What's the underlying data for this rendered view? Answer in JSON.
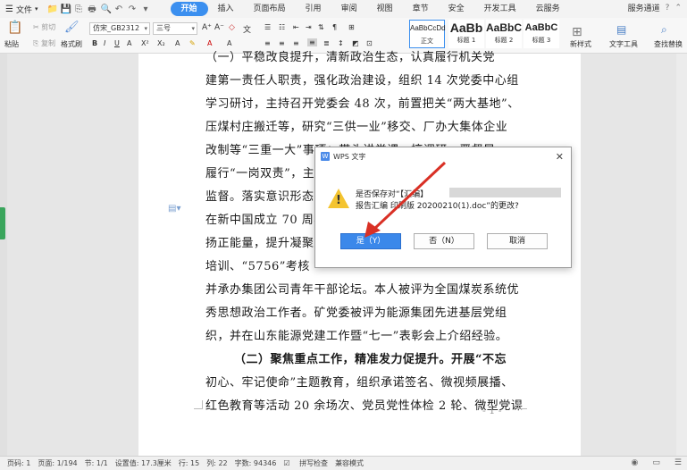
{
  "menubar": {
    "file_label": "文件",
    "tabs": [
      "开始",
      "插入",
      "页面布局",
      "引用",
      "审阅",
      "视图",
      "章节",
      "安全",
      "开发工具",
      "云服务"
    ],
    "active_tab": "开始",
    "right_label": "服务通道"
  },
  "ribbon": {
    "paste": "粘贴",
    "cut": "剪切",
    "copy": "复制",
    "format_painter": "格式刷",
    "font_name": "仿宋_GB2312",
    "font_size": "三号",
    "styles": [
      {
        "preview": "AaBbCcDd",
        "label": "正文"
      },
      {
        "preview": "AaBb",
        "label": "标题 1"
      },
      {
        "preview": "AaBbC",
        "label": "标题 2"
      },
      {
        "preview": "AaBbC",
        "label": "标题 3"
      }
    ],
    "new_style": "新样式",
    "text_tools": "文字工具",
    "find_replace": "查找替换"
  },
  "document": {
    "lines": [
      {
        "text": "（一）平稳改良提升，清新政治生态，认真履行机关党",
        "bold": false
      },
      {
        "text": "建第一责任人职责，强化政治建设，组织 14 次党委中心组",
        "bold": false
      },
      {
        "text": "学习研讨，主持召开党委会 48 次，前置把关“两大基地”、",
        "bold": false
      },
      {
        "text": "压煤村庄搬迁等，研究“三供一业”移交、厂办大集体企业",
        "bold": false
      },
      {
        "text": "改制等“三重一大”事项；带头讲党课，搞调研，严督导，",
        "bold": false
      },
      {
        "text": "履行“一岗双责”，主",
        "bold": false
      },
      {
        "text": "监督。落实意识形态工",
        "bold": false
      },
      {
        "text": "在新中国成立 70 周年",
        "bold": false
      },
      {
        "text": "扬正能量，提升凝聚力",
        "bold": false
      },
      {
        "text": "培训、“5756”考核",
        "bold": false
      },
      {
        "text": "并承办集团公司青年干部论坛。本人被评为全国煤炭系统优",
        "bold": false
      },
      {
        "text": "秀思想政治工作者。矿党委被评为能源集团先进基层党组",
        "bold": false
      },
      {
        "text": "织，并在山东能源党建工作暨“七一”表彰会上介绍经验。",
        "bold": false
      },
      {
        "text": "（二）聚焦重点工作，精准发力促提升。开展“不忘",
        "bold": true
      },
      {
        "text": "初心、牢记使命”主题教育，组织承诺签名、微视频展播、",
        "bold": false
      },
      {
        "text": "红色教育等活动 20 余场次、党员党性体检 2 轮、微型党课",
        "bold": false
      }
    ],
    "page_number": "- 1 -"
  },
  "dialog": {
    "title": "WPS 文字",
    "msg1": "是否保存对“【汇编】",
    "msg2": "报告汇编 印刷版 20200210(1).doc”的更改?",
    "yes": "是（Y）",
    "no": "否（N）",
    "cancel": "取消"
  },
  "status": {
    "page_code": "页码: 1",
    "pages": "页面: 1/194",
    "section": "节: 1/1",
    "setting": "设置值: 17.3厘米",
    "row": "行: 15",
    "col": "列: 22",
    "words": "字数: 94346",
    "spellcheck": "拼写检查",
    "compat": "兼容模式"
  },
  "colors": {
    "accent": "#3b8fef",
    "warning": "#f4c430",
    "arrow": "#d93025"
  }
}
